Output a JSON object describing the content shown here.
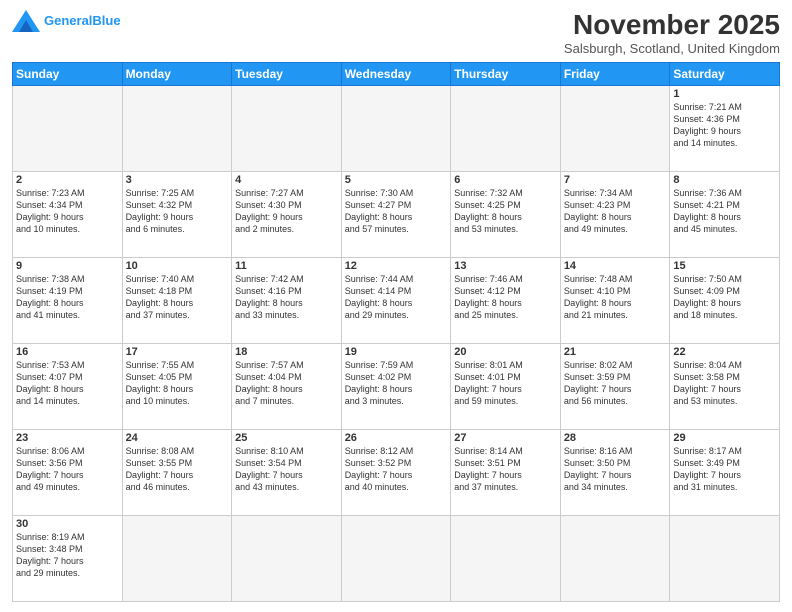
{
  "header": {
    "logo_line1": "General",
    "logo_line2": "Blue",
    "month_title": "November 2025",
    "location": "Salsburgh, Scotland, United Kingdom"
  },
  "days_of_week": [
    "Sunday",
    "Monday",
    "Tuesday",
    "Wednesday",
    "Thursday",
    "Friday",
    "Saturday"
  ],
  "weeks": [
    [
      {
        "day": "",
        "info": ""
      },
      {
        "day": "",
        "info": ""
      },
      {
        "day": "",
        "info": ""
      },
      {
        "day": "",
        "info": ""
      },
      {
        "day": "",
        "info": ""
      },
      {
        "day": "",
        "info": ""
      },
      {
        "day": "1",
        "info": "Sunrise: 7:21 AM\nSunset: 4:36 PM\nDaylight: 9 hours\nand 14 minutes."
      }
    ],
    [
      {
        "day": "2",
        "info": "Sunrise: 7:23 AM\nSunset: 4:34 PM\nDaylight: 9 hours\nand 10 minutes."
      },
      {
        "day": "3",
        "info": "Sunrise: 7:25 AM\nSunset: 4:32 PM\nDaylight: 9 hours\nand 6 minutes."
      },
      {
        "day": "4",
        "info": "Sunrise: 7:27 AM\nSunset: 4:30 PM\nDaylight: 9 hours\nand 2 minutes."
      },
      {
        "day": "5",
        "info": "Sunrise: 7:30 AM\nSunset: 4:27 PM\nDaylight: 8 hours\nand 57 minutes."
      },
      {
        "day": "6",
        "info": "Sunrise: 7:32 AM\nSunset: 4:25 PM\nDaylight: 8 hours\nand 53 minutes."
      },
      {
        "day": "7",
        "info": "Sunrise: 7:34 AM\nSunset: 4:23 PM\nDaylight: 8 hours\nand 49 minutes."
      },
      {
        "day": "8",
        "info": "Sunrise: 7:36 AM\nSunset: 4:21 PM\nDaylight: 8 hours\nand 45 minutes."
      }
    ],
    [
      {
        "day": "9",
        "info": "Sunrise: 7:38 AM\nSunset: 4:19 PM\nDaylight: 8 hours\nand 41 minutes."
      },
      {
        "day": "10",
        "info": "Sunrise: 7:40 AM\nSunset: 4:18 PM\nDaylight: 8 hours\nand 37 minutes."
      },
      {
        "day": "11",
        "info": "Sunrise: 7:42 AM\nSunset: 4:16 PM\nDaylight: 8 hours\nand 33 minutes."
      },
      {
        "day": "12",
        "info": "Sunrise: 7:44 AM\nSunset: 4:14 PM\nDaylight: 8 hours\nand 29 minutes."
      },
      {
        "day": "13",
        "info": "Sunrise: 7:46 AM\nSunset: 4:12 PM\nDaylight: 8 hours\nand 25 minutes."
      },
      {
        "day": "14",
        "info": "Sunrise: 7:48 AM\nSunset: 4:10 PM\nDaylight: 8 hours\nand 21 minutes."
      },
      {
        "day": "15",
        "info": "Sunrise: 7:50 AM\nSunset: 4:09 PM\nDaylight: 8 hours\nand 18 minutes."
      }
    ],
    [
      {
        "day": "16",
        "info": "Sunrise: 7:53 AM\nSunset: 4:07 PM\nDaylight: 8 hours\nand 14 minutes."
      },
      {
        "day": "17",
        "info": "Sunrise: 7:55 AM\nSunset: 4:05 PM\nDaylight: 8 hours\nand 10 minutes."
      },
      {
        "day": "18",
        "info": "Sunrise: 7:57 AM\nSunset: 4:04 PM\nDaylight: 8 hours\nand 7 minutes."
      },
      {
        "day": "19",
        "info": "Sunrise: 7:59 AM\nSunset: 4:02 PM\nDaylight: 8 hours\nand 3 minutes."
      },
      {
        "day": "20",
        "info": "Sunrise: 8:01 AM\nSunset: 4:01 PM\nDaylight: 7 hours\nand 59 minutes."
      },
      {
        "day": "21",
        "info": "Sunrise: 8:02 AM\nSunset: 3:59 PM\nDaylight: 7 hours\nand 56 minutes."
      },
      {
        "day": "22",
        "info": "Sunrise: 8:04 AM\nSunset: 3:58 PM\nDaylight: 7 hours\nand 53 minutes."
      }
    ],
    [
      {
        "day": "23",
        "info": "Sunrise: 8:06 AM\nSunset: 3:56 PM\nDaylight: 7 hours\nand 49 minutes."
      },
      {
        "day": "24",
        "info": "Sunrise: 8:08 AM\nSunset: 3:55 PM\nDaylight: 7 hours\nand 46 minutes."
      },
      {
        "day": "25",
        "info": "Sunrise: 8:10 AM\nSunset: 3:54 PM\nDaylight: 7 hours\nand 43 minutes."
      },
      {
        "day": "26",
        "info": "Sunrise: 8:12 AM\nSunset: 3:52 PM\nDaylight: 7 hours\nand 40 minutes."
      },
      {
        "day": "27",
        "info": "Sunrise: 8:14 AM\nSunset: 3:51 PM\nDaylight: 7 hours\nand 37 minutes."
      },
      {
        "day": "28",
        "info": "Sunrise: 8:16 AM\nSunset: 3:50 PM\nDaylight: 7 hours\nand 34 minutes."
      },
      {
        "day": "29",
        "info": "Sunrise: 8:17 AM\nSunset: 3:49 PM\nDaylight: 7 hours\nand 31 minutes."
      }
    ],
    [
      {
        "day": "30",
        "info": "Sunrise: 8:19 AM\nSunset: 3:48 PM\nDaylight: 7 hours\nand 29 minutes."
      },
      {
        "day": "",
        "info": ""
      },
      {
        "day": "",
        "info": ""
      },
      {
        "day": "",
        "info": ""
      },
      {
        "day": "",
        "info": ""
      },
      {
        "day": "",
        "info": ""
      },
      {
        "day": "",
        "info": ""
      }
    ]
  ]
}
